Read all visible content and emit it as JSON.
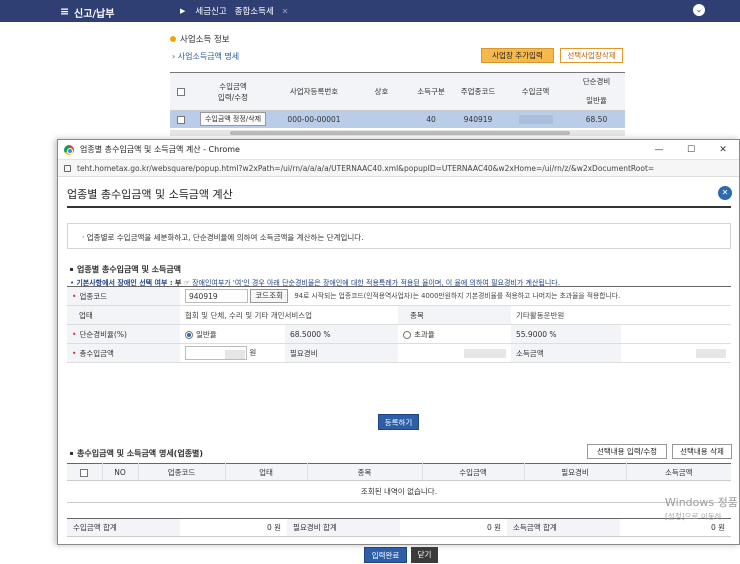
{
  "app": {
    "menu_label": "신고/납부",
    "crumbs": [
      "세금신고",
      "종합소득세"
    ]
  },
  "background": {
    "section_title": "사업소득 정보",
    "sub_title": "사업소득금액 명세",
    "add_button": "사업장 추가입력",
    "delete_button": "선택사업장삭제",
    "table_headers": [
      "수입금액\n입력/수정",
      "사업자등록번호",
      "상호",
      "소득구분",
      "주업종코드",
      "수입금액",
      "단순경비",
      "일반율"
    ],
    "row": {
      "edit_button": "수입금액 정정/삭제",
      "biz_no": "000-00-00001",
      "code_type": "40",
      "industry_code": "940919",
      "rate": "68.50"
    }
  },
  "popup": {
    "window_title": "업종별 총수입금액 및 소득금액 계산 - Chrome",
    "url": "teht.hometax.go.kr/websquare/popup.html?w2xPath=/ui/rn/a/a/a/a/UTERNAAC40.xml&popupID=UTERNAAC40&w2xHome=/ui/rn/z/&w2xDocumentRoot=",
    "heading": "업종별 총수입금액 및 소득금액 계산",
    "notice": "업종별로 수입금액을 세분화하고, 단순경비율에 의하여 소득금액을 계산하는 단계입니다.",
    "section1_title": "업종별 총수입금액 및 소득금액",
    "info_label": "기본사항에서 장애인 선택 여부 :",
    "info_value": "부",
    "info_note": "☞ 장애인여부가 '여'인 경우 아래 단순경비율은 장애인에 대한 적용특례가 적용된 율이며, 이 율에 의하여 필요경비가 계산됩니다.",
    "form": {
      "code_label": "업종코드",
      "code_value": "940919",
      "code_button": "코드조회",
      "code_note": "94로 시작되는 업종코드(인적용역사업자)는 4000만원하지 기본경비율를 적용하고 나머지는 초과율을 적용합니다.",
      "type_label": "업태",
      "type_value": "협회 및 단체, 수리 및 기타 개인서비스업",
      "item_label": "종목",
      "item_value": "기타활동운반원",
      "rate_label": "단순경비율(%)",
      "rate_general_label": "일반율",
      "rate_general_value": "68.5000 %",
      "rate_excess_label": "초과율",
      "rate_excess_value": "55.9000 %",
      "revenue_label": "총수입금액",
      "revenue_unit": "원",
      "expense_label": "필요경비",
      "income_label": "소득금액"
    },
    "register_button": "등록하기",
    "section2_title": "총수입금액 및 소득금액 명세(업종별)",
    "edit_selected_button": "선택내용 입력/수정",
    "delete_selected_button": "선택내용 삭제",
    "list_headers": [
      "NO",
      "업종코드",
      "업태",
      "종목",
      "수입금액",
      "필요경비",
      "소득금액"
    ],
    "empty_message": "조회된 내역이 없습니다.",
    "summary": {
      "revenue_label": "수입금액 합계",
      "revenue_value": "0 원",
      "expense_label": "필요경비 합계",
      "expense_value": "0 원",
      "income_label": "소득금액 합계",
      "income_value": "0 원"
    },
    "complete_button": "입력완료",
    "close_button": "닫기"
  },
  "watermark": {
    "line1": "Windows 정품",
    "line2": "[설정]으로 이동하"
  }
}
